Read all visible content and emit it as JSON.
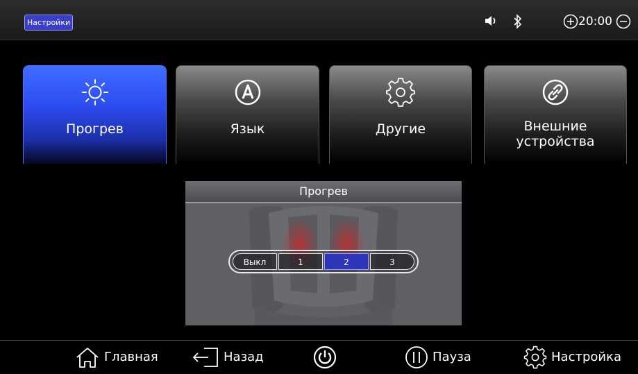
{
  "header": {
    "title": "Настройки",
    "clock": "20:00",
    "icons": [
      "volume-icon",
      "bluetooth-icon",
      "volume-down-icon",
      "volume-up-icon"
    ]
  },
  "tabs": [
    {
      "label": "Прогрев",
      "icon": "sun-icon",
      "active": true
    },
    {
      "label": "Язык",
      "icon": "language-a-icon",
      "active": false
    },
    {
      "label": "Другие",
      "icon": "gear-icon",
      "active": false
    },
    {
      "label_line1": "Внешние",
      "label_line2": "устройства",
      "icon": "link-icon",
      "active": false
    }
  ],
  "panel": {
    "title": "Прогрев",
    "options": [
      "Выкл",
      "1",
      "2",
      "3"
    ],
    "selected": "2"
  },
  "nav": {
    "home": "Главная",
    "back": "Назад",
    "pause": "Пауза",
    "settings": "Настройка"
  },
  "colors": {
    "accent": "#2d4df2",
    "selected": "#2f35b8",
    "background": "#000000"
  }
}
